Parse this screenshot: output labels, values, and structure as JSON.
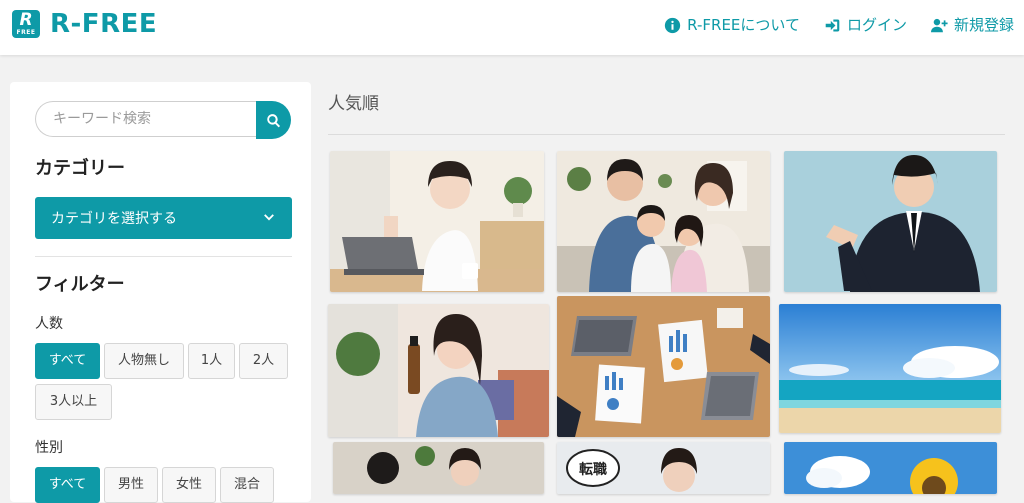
{
  "header": {
    "logo_big": "R",
    "logo_small": "FREE",
    "logo_text": "R-FREE",
    "nav": [
      {
        "label": "R-FREEについて",
        "icon": "info-icon"
      },
      {
        "label": "ログイン",
        "icon": "login-icon"
      },
      {
        "label": "新規登録",
        "icon": "user-plus-icon"
      }
    ]
  },
  "sidebar": {
    "search_placeholder": "キーワード検索",
    "category_title": "カテゴリー",
    "category_select_label": "カテゴリを選択する",
    "filter_title": "フィルター",
    "people_label": "人数",
    "people_options": [
      "すべて",
      "人物無し",
      "1人",
      "2人",
      "3人以上"
    ],
    "people_selected": "すべて",
    "gender_label": "性別",
    "gender_options": [
      "すべて",
      "男性",
      "女性",
      "混合"
    ],
    "gender_selected": "すべて"
  },
  "main": {
    "title": "人気順",
    "photos": [
      {
        "desc": "woman-laptop-ok-sign"
      },
      {
        "desc": "family-of-four"
      },
      {
        "desc": "businessman-pointing"
      },
      {
        "desc": "woman-skincare-bottle"
      },
      {
        "desc": "business-charts-desk"
      },
      {
        "desc": "beach-blue-sky"
      },
      {
        "desc": "office-people"
      },
      {
        "desc": "tenshoku-woman",
        "text": "転職"
      },
      {
        "desc": "sunflower-sky"
      }
    ]
  },
  "colors": {
    "accent": "#0e9aa7",
    "background": "#f2f2f2"
  }
}
